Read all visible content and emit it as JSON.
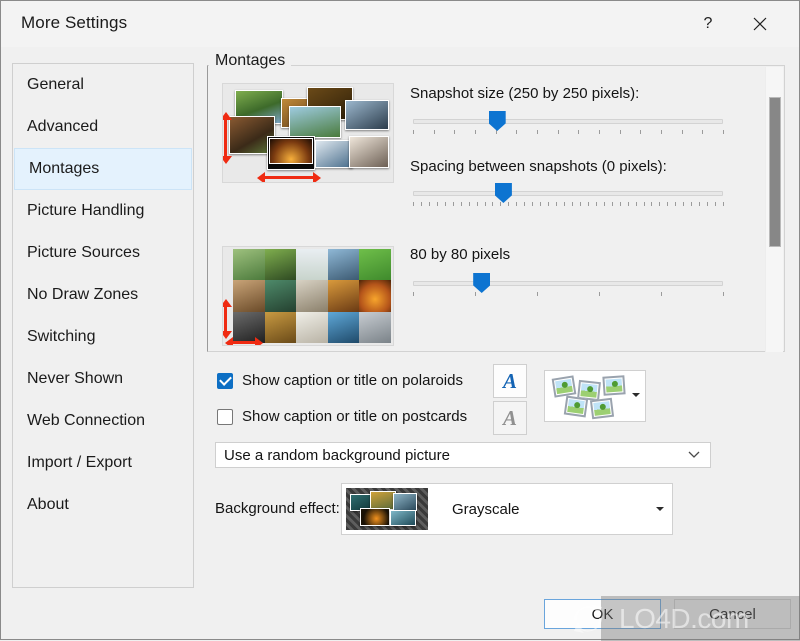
{
  "window": {
    "title": "More Settings",
    "help_icon": "question-mark-icon",
    "close_icon": "close-icon"
  },
  "sidebar": {
    "items": [
      {
        "label": "General",
        "selected": false
      },
      {
        "label": "Advanced",
        "selected": false
      },
      {
        "label": "Montages",
        "selected": true
      },
      {
        "label": "Picture Handling",
        "selected": false
      },
      {
        "label": "Picture Sources",
        "selected": false
      },
      {
        "label": "No Draw Zones",
        "selected": false
      },
      {
        "label": "Switching",
        "selected": false
      },
      {
        "label": "Never Shown",
        "selected": false
      },
      {
        "label": "Web Connection",
        "selected": false
      },
      {
        "label": "Import / Export",
        "selected": false
      },
      {
        "label": "About",
        "selected": false
      }
    ]
  },
  "main": {
    "group_title": "Montages",
    "sliders": [
      {
        "label": "Snapshot size (250 by 250 pixels):",
        "value_pct": 27,
        "ticks": 16
      },
      {
        "label": "Spacing between snapshots (0 pixels):",
        "value_pct": 29,
        "ticks": 40
      },
      {
        "label": "80 by 80 pixels",
        "value_pct": 22,
        "ticks": 6
      }
    ],
    "checkboxes": [
      {
        "label": "Show caption or title on polaroids",
        "checked": true,
        "font_button": "font-A-icon",
        "font_enabled": true
      },
      {
        "label": "Show caption or title on postcards",
        "checked": false,
        "font_button": "font-A-icon",
        "font_enabled": false
      }
    ],
    "layout_picker": {
      "name": "montage-layout-picker",
      "arrow": "dropdown-arrow-icon"
    },
    "background_combo": {
      "value": "Use a random background picture",
      "chevron": "chevron-down-icon"
    },
    "background_effect": {
      "label": "Background effect:",
      "value": "Grayscale",
      "arrow": "dropdown-arrow-icon"
    }
  },
  "footer": {
    "ok_label": "OK",
    "cancel_label": "Cancel"
  },
  "watermark": {
    "text": "LO4D.com"
  },
  "colors": {
    "accent": "#0d74d1",
    "selection_bg": "#e4f2fd",
    "selection_border": "#cce4f7",
    "window_bg": "#f0f0f0",
    "arrow_red": "#ef2b12",
    "focus_border": "#6aa5dc"
  }
}
